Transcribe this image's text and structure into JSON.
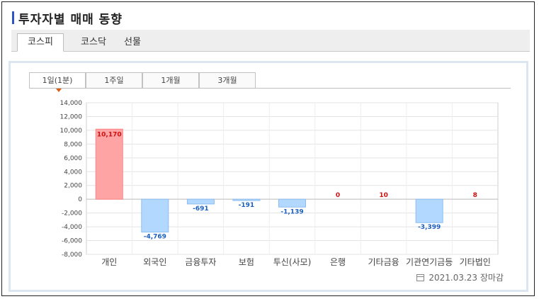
{
  "header": {
    "title": "투자자별 매매 동향"
  },
  "market_tabs": [
    {
      "label": "코스피",
      "active": true
    },
    {
      "label": "코스닥",
      "active": false
    },
    {
      "label": "선물",
      "active": false
    }
  ],
  "period_tabs": [
    {
      "label": "1일(1분)",
      "active": true
    },
    {
      "label": "1주일",
      "active": false
    },
    {
      "label": "1개월",
      "active": false
    },
    {
      "label": "3개월",
      "active": false
    }
  ],
  "footer": {
    "date_text": "2021.03.23 장마감",
    "icon": "calendar-icon"
  },
  "colors": {
    "positive_fill": "#ffa4a4",
    "positive_stroke": "#ff8585",
    "negative_fill": "#b3d8ff",
    "negative_stroke": "#8cbdf0",
    "positive_text": "#d01010",
    "negative_text": "#1a5fc0"
  },
  "chart_data": {
    "type": "bar",
    "title": "",
    "xlabel": "",
    "ylabel": "",
    "categories": [
      "개인",
      "외국인",
      "금융투자",
      "보험",
      "투신(사모)",
      "은행",
      "기타금융",
      "기관연기금등",
      "기타법인"
    ],
    "values": [
      10170,
      -4769,
      -691,
      -191,
      -1139,
      0,
      10,
      -3399,
      8
    ],
    "value_labels": [
      "10,170",
      "-4,769",
      "-691",
      "-191",
      "-1,139",
      "0",
      "10",
      "-3,399",
      "8"
    ],
    "ylim": [
      -8000,
      14000
    ],
    "yticks": [
      14000,
      12000,
      10000,
      8000,
      6000,
      4000,
      2000,
      0,
      -2000,
      -4000,
      -6000,
      -8000
    ],
    "ytick_labels": [
      "14,000",
      "12,000",
      "10,000",
      "8,000",
      "6,000",
      "4,000",
      "2,000",
      "0",
      "-2,000",
      "-4,000",
      "-6,000",
      "-8,000"
    ],
    "grid": true,
    "legend": "none"
  }
}
